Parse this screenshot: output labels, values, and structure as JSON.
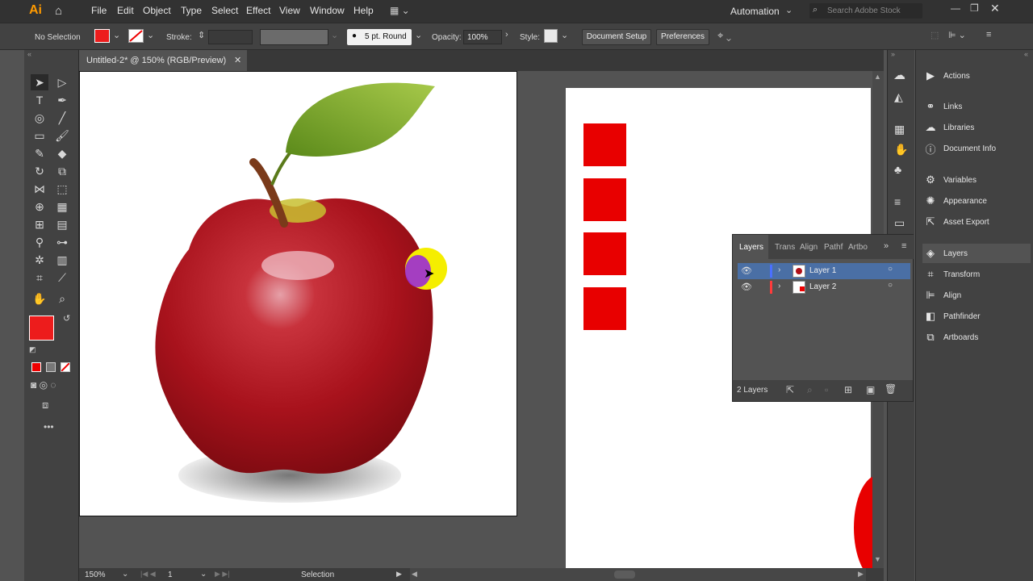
{
  "app": {
    "logo": "Ai"
  },
  "menu": [
    "File",
    "Edit",
    "Object",
    "Type",
    "Select",
    "Effect",
    "View",
    "Window",
    "Help"
  ],
  "workspace": {
    "label": "Automation",
    "search_placeholder": "Search Adobe Stock"
  },
  "control": {
    "selection_label": "No Selection",
    "stroke_label": "Stroke:",
    "brush_label": "5 pt. Round",
    "opacity_label": "Opacity:",
    "opacity_value": "100%",
    "style_label": "Style:",
    "doc_setup": "Document Setup",
    "preferences": "Preferences",
    "fill_color": "#ed1c1c"
  },
  "document": {
    "tab_title": "Untitled-2* @ 150% (RGB/Preview)"
  },
  "status": {
    "zoom": "150%",
    "artboard": "1",
    "tool": "Selection"
  },
  "dock": [
    {
      "icon": "play-icon",
      "label": "Actions"
    },
    {
      "icon": "link-icon",
      "label": "Links"
    },
    {
      "icon": "cc-libraries-icon",
      "label": "Libraries"
    },
    {
      "icon": "info-icon",
      "label": "Document Info"
    },
    {
      "icon": "variables-icon",
      "label": "Variables"
    },
    {
      "icon": "appearance-icon",
      "label": "Appearance"
    },
    {
      "icon": "export-icon",
      "label": "Asset Export"
    },
    {
      "icon": "layers-icon",
      "label": "Layers"
    },
    {
      "icon": "transform-icon",
      "label": "Transform"
    },
    {
      "icon": "align-icon",
      "label": "Align"
    },
    {
      "icon": "pathfinder-icon",
      "label": "Pathfinder"
    },
    {
      "icon": "artboards-icon",
      "label": "Artboards"
    }
  ],
  "layers_panel": {
    "tabs": [
      "Layers",
      "Trans",
      "Align",
      "Pathf",
      "Artbo"
    ],
    "layers": [
      {
        "name": "Layer 1",
        "color": "#4a6fff"
      },
      {
        "name": "Layer 2",
        "color": "#ff3b3b"
      }
    ],
    "count": "2 Layers"
  }
}
